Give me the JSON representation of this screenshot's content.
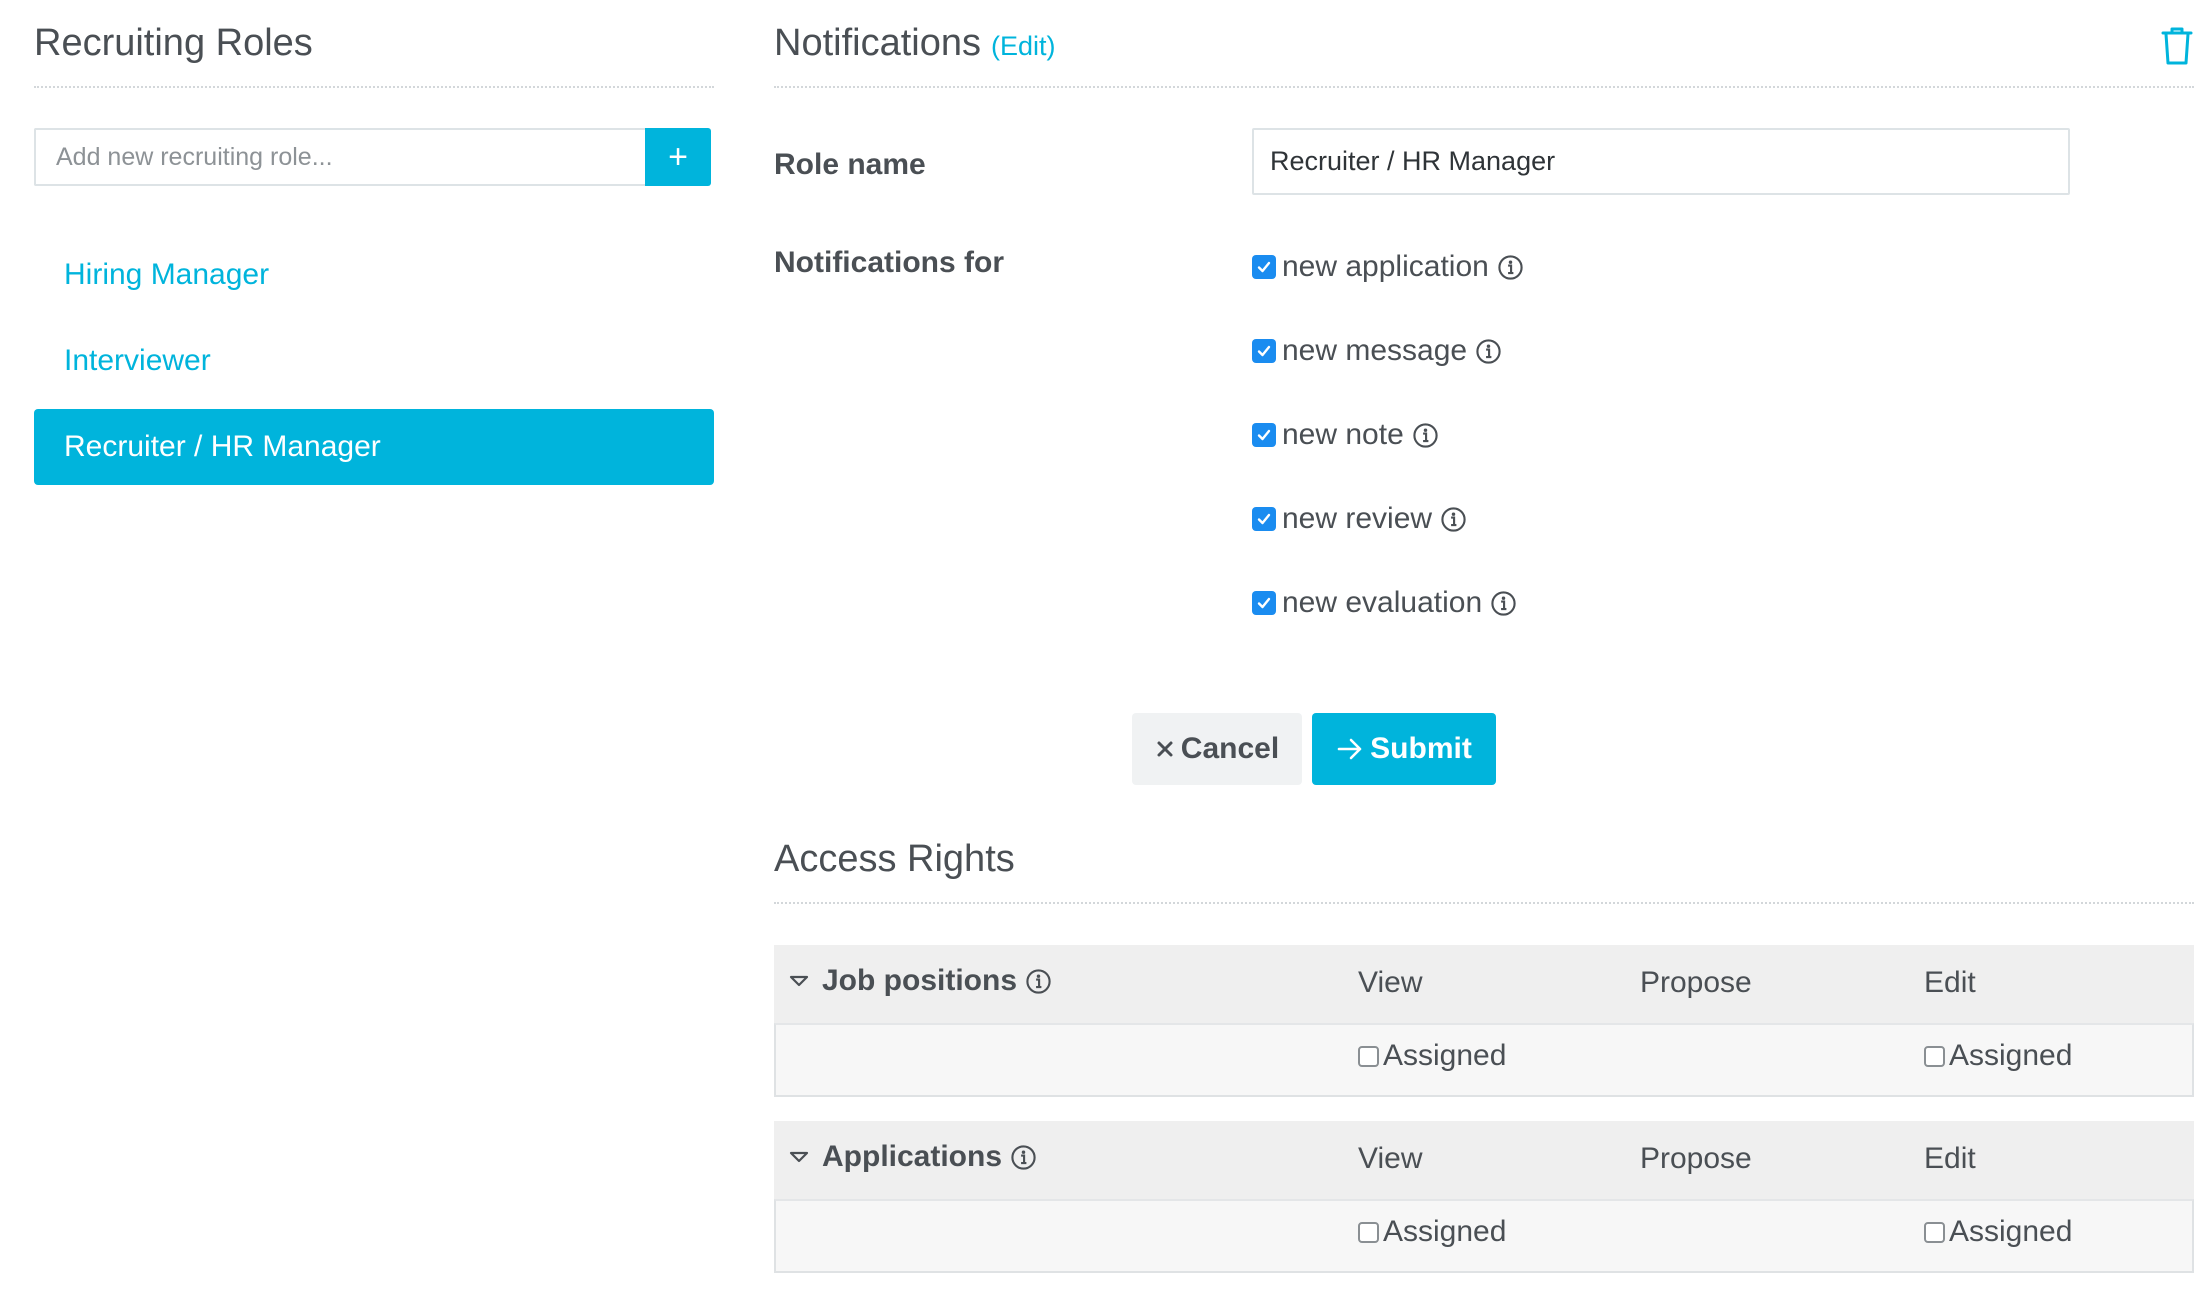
{
  "left_panel": {
    "title": "Recruiting Roles",
    "add_placeholder": "Add new recruiting role...",
    "add_button_label": "+",
    "roles": [
      {
        "label": "Hiring Manager",
        "active": false
      },
      {
        "label": "Interviewer",
        "active": false
      },
      {
        "label": "Recruiter / HR Manager",
        "active": true
      }
    ]
  },
  "notifications_panel": {
    "title": "Notifications",
    "edit_link": "(Edit)",
    "role_name_label": "Role name",
    "role_name_value": "Recruiter / HR Manager",
    "notifications_for_label": "Notifications for",
    "options": [
      {
        "label": "new application",
        "checked": true
      },
      {
        "label": "new message",
        "checked": true
      },
      {
        "label": "new note",
        "checked": true
      },
      {
        "label": "new review",
        "checked": true
      },
      {
        "label": "new evaluation",
        "checked": true
      }
    ],
    "cancel_label": "Cancel",
    "submit_label": "Submit"
  },
  "access_rights": {
    "title": "Access Rights",
    "sections": [
      {
        "title": "Job positions",
        "columns": [
          "View",
          "Propose",
          "Edit"
        ],
        "view_option": "Assigned",
        "edit_option": "Assigned"
      },
      {
        "title": "Applications",
        "columns": [
          "View",
          "Propose",
          "Edit"
        ],
        "view_option": "Assigned",
        "edit_option": "Assigned"
      }
    ]
  },
  "colors": {
    "accent": "#00b4dc",
    "checkbox": "#1a8cf0",
    "text": "#4a4f54"
  }
}
